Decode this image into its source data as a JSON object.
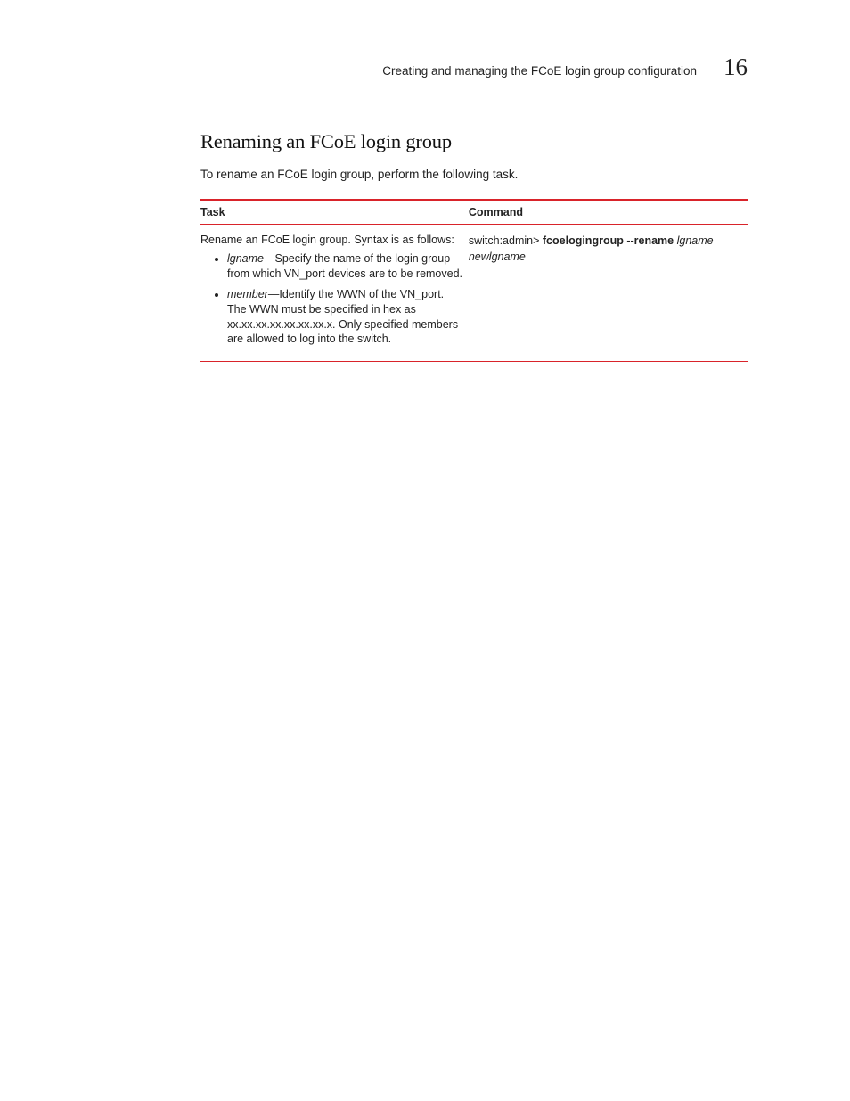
{
  "header": {
    "title": "Creating and managing the FCoE login group configuration",
    "chapter": "16"
  },
  "section": {
    "heading": "Renaming an FCoE login group",
    "intro": "To rename an FCoE login group, perform the following task."
  },
  "table": {
    "head": {
      "task": "Task",
      "command": "Command"
    },
    "row": {
      "task_intro": "Rename an FCoE login group. Syntax is as follows:",
      "bullets": [
        {
          "term": "lgname",
          "desc": "—Specify the name of the login group from which VN_port devices are to be removed."
        },
        {
          "term": "member",
          "desc": "—Identify the WWN of the VN_port. The WWN must be specified in hex as xx.xx.xx.xx.xx.xx.xx.x. Only specified members are allowed to log into the switch."
        }
      ],
      "cmd": {
        "prompt": "switch:admin> ",
        "keyword": "fcoelogingroup --rename",
        "arg1": " lgname",
        "arg2": "newlgname"
      }
    }
  }
}
